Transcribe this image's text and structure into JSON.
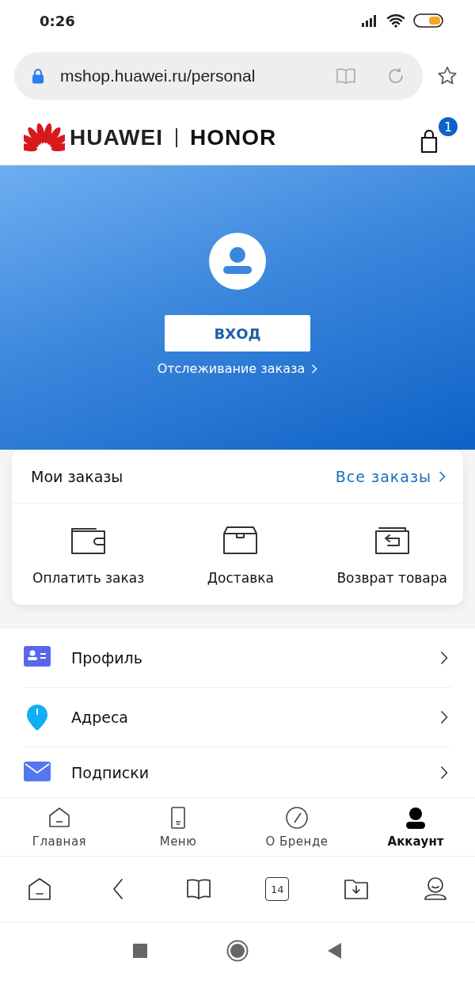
{
  "status_bar": {
    "time": "0:26"
  },
  "address_bar": {
    "url": "mshop.huawei.ru/personal"
  },
  "header": {
    "logo_left": "HUAWEI",
    "logo_right": "HONOR",
    "cart_count": "1"
  },
  "hero": {
    "login_button": "ВХОД",
    "track_link": "Отслеживание заказа"
  },
  "orders": {
    "title": "Мои заказы",
    "all_link": "Все заказы",
    "actions": [
      {
        "kind": "wallet",
        "label": "Оплатить заказ"
      },
      {
        "kind": "box",
        "label": "Доставка"
      },
      {
        "kind": "return",
        "label": "Возврат товара"
      }
    ]
  },
  "menu": [
    {
      "kind": "profile",
      "label": "Профиль",
      "color": "#5b67ea"
    },
    {
      "kind": "address",
      "label": "Адреса",
      "color": "#10aef5"
    },
    {
      "kind": "mail",
      "label": "Подписки",
      "color": "#5577ee"
    }
  ],
  "tabs": [
    {
      "kind": "home",
      "label": "Главная",
      "selected": false
    },
    {
      "kind": "menu",
      "label": "Меню",
      "selected": false
    },
    {
      "kind": "brand",
      "label": "О Бренде",
      "selected": false
    },
    {
      "kind": "account",
      "label": "Аккаунт",
      "selected": true
    }
  ],
  "browser_toolbar": {
    "tab_count": "14"
  }
}
